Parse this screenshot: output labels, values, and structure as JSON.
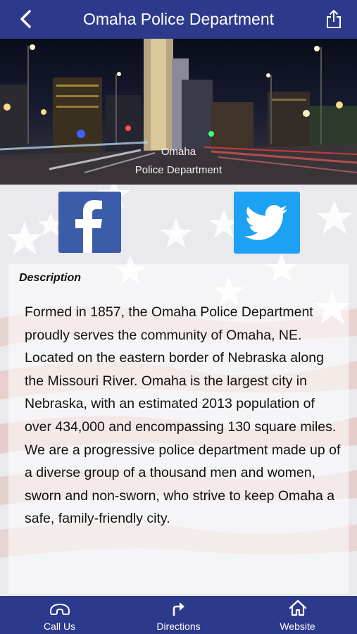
{
  "header": {
    "title": "Omaha Police Department",
    "back_icon": "chevron-left-icon",
    "share_icon": "share-icon"
  },
  "hero": {
    "caption_line1": "Omaha",
    "caption_line2": "Police Department"
  },
  "social": {
    "facebook_icon": "facebook-icon",
    "twitter_icon": "twitter-icon"
  },
  "description": {
    "heading": "Description",
    "body": "Formed in 1857, the Omaha Police Department proudly serves the community of Omaha, NE. Located on the eastern border of Nebraska along the Missouri River. Omaha is the largest city in Nebraska, with an estimated 2013 population of over 434,000 and encompassing 130 square miles. We are a progressive police department made up of a diverse group of a thousand men and women, sworn and non-sworn, who strive to keep Omaha a safe, family-friendly city."
  },
  "tabs": [
    {
      "label": "Call Us",
      "icon": "phone-icon"
    },
    {
      "label": "Directions",
      "icon": "directions-arrow-icon"
    },
    {
      "label": "Website",
      "icon": "home-icon"
    }
  ],
  "colors": {
    "bar": "#2d3a8c",
    "facebook": "#3b5ca8",
    "twitter": "#1da1f2"
  }
}
